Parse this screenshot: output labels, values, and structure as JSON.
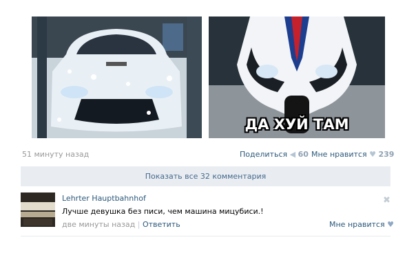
{
  "post": {
    "time": "51 минуту назад",
    "meme_caption": "ДА ХУЙ ТАМ"
  },
  "actions": {
    "share_label": "Поделиться",
    "share_count": "60",
    "like_label": "Мне нравится",
    "like_count": "239"
  },
  "comments_bar": {
    "label": "Показать все 32 комментария"
  },
  "comment": {
    "author": "Lehrter Hauptbahnhof",
    "text": "Лучше девушка без писи, чем машина мицубиси.!",
    "time": "две минуты назад",
    "reply_label": "Ответить",
    "like_label": "Мне нравится"
  },
  "icons": {
    "share": "megaphone-icon",
    "like": "heart-icon",
    "close": "close-icon"
  }
}
